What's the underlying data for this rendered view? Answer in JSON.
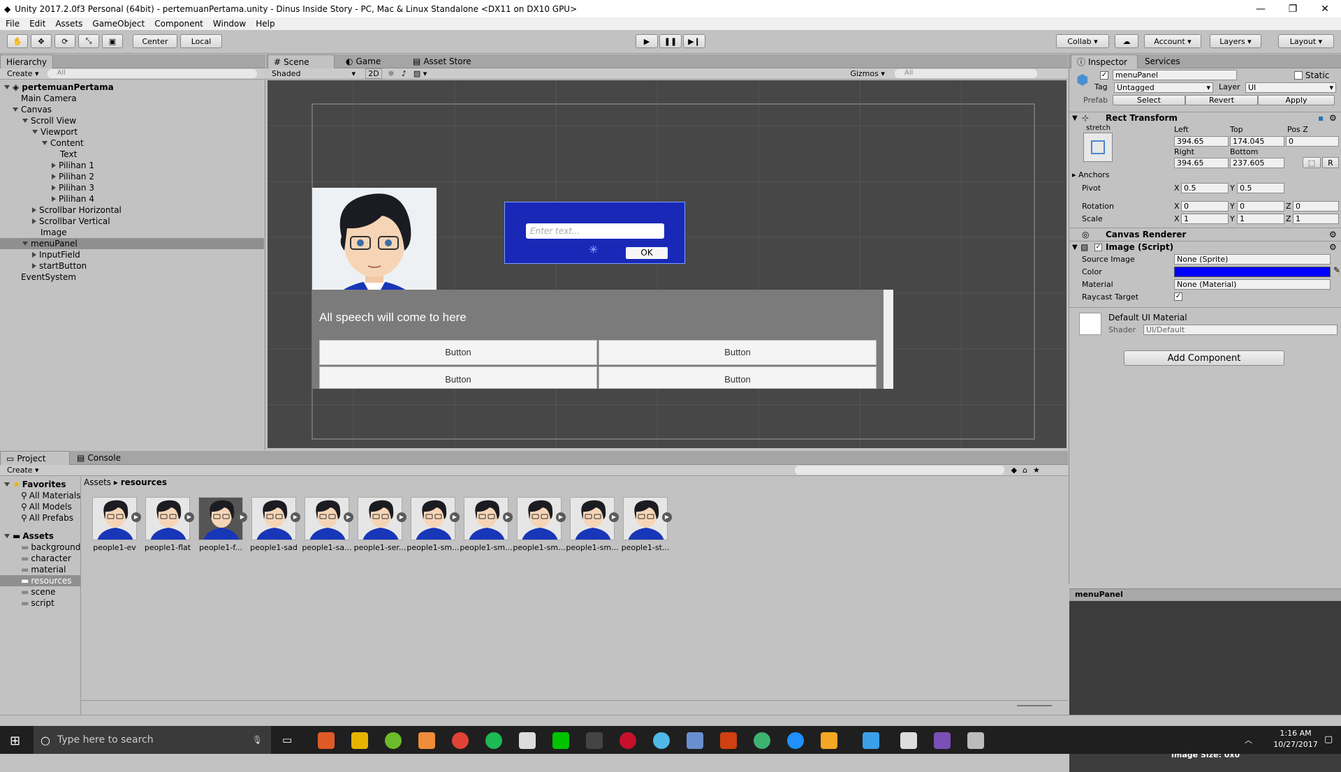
{
  "window": {
    "title": "Unity 2017.2.0f3 Personal (64bit) - pertemuanPertama.unity - Dinus Inside Story - PC, Mac & Linux Standalone <DX11 on DX10 GPU>"
  },
  "menu": [
    "File",
    "Edit",
    "Assets",
    "GameObject",
    "Component",
    "Window",
    "Help"
  ],
  "toolbar": {
    "center": "Center",
    "local": "Local",
    "collab": "Collab",
    "account": "Account",
    "layers": "Layers",
    "layout": "Layout"
  },
  "hierarchy": {
    "tab": "Hierarchy",
    "create": "Create",
    "search_placeholder": "All",
    "scene": "pertemuanPertama",
    "items": [
      "Main Camera",
      "Canvas",
      "Scroll View",
      "Viewport",
      "Content",
      "Text",
      "Pilihan 1",
      "Pilihan 2",
      "Pilihan 3",
      "Pilihan 4",
      "Scrollbar Horizontal",
      "Scrollbar Vertical",
      "Image",
      "menuPanel",
      "InputField",
      "startButton",
      "EventSystem"
    ]
  },
  "scene": {
    "tabs": [
      "Scene",
      "Game",
      "Asset Store"
    ],
    "shading": "Shaded",
    "mode2d": "2D",
    "gizmos": "Gizmos",
    "search_placeholder": "All",
    "input_placeholder": "Enter text...",
    "ok": "OK",
    "speech": "All speech will come to here",
    "button": "Button",
    "panel_color": "#1a28b8"
  },
  "inspector": {
    "tabs": [
      "Inspector",
      "Services"
    ],
    "name": "menuPanel",
    "static": "Static",
    "tag_label": "Tag",
    "tag": "Untagged",
    "layer_label": "Layer",
    "layer": "UI",
    "prefab": "Prefab",
    "select": "Select",
    "revert": "Revert",
    "apply": "Apply",
    "rect": "Rect Transform",
    "stretch": "stretch",
    "left_l": "Left",
    "top_l": "Top",
    "posz_l": "Pos Z",
    "left": "394.65",
    "top": "174.045",
    "posz": "0",
    "right_l": "Right",
    "bottom_l": "Bottom",
    "right": "394.65",
    "bottom": "237.605",
    "r": "R",
    "anchors": "Anchors",
    "pivot": "Pivot",
    "px": "0.5",
    "py": "0.5",
    "rotation": "Rotation",
    "rx": "0",
    "ry": "0",
    "rz": "0",
    "scale": "Scale",
    "sx": "1",
    "sy": "1",
    "sz": "1",
    "x": "X",
    "y": "Y",
    "z": "Z",
    "canvas_renderer": "Canvas Renderer",
    "image_script": "Image (Script)",
    "source_image_l": "Source Image",
    "source_image": "None (Sprite)",
    "color_l": "Color",
    "color": "#0000ff",
    "material_l": "Material",
    "material": "None (Material)",
    "raycast": "Raycast Target",
    "default_mat": "Default UI Material",
    "shader_l": "Shader",
    "shader": "UI/Default",
    "add_component": "Add Component",
    "preview_title": "menuPanel",
    "preview_name": "menuPanel",
    "preview_size": "Image Size: 0x0"
  },
  "project": {
    "tabs": [
      "Project",
      "Console"
    ],
    "create": "Create",
    "favorites": "Favorites",
    "fav_items": [
      "All Materials",
      "All Models",
      "All Prefabs"
    ],
    "assets": "Assets",
    "folders": [
      "background",
      "character",
      "material",
      "resources",
      "scene",
      "script"
    ],
    "breadcrumb": [
      "Assets",
      "resources"
    ],
    "files": [
      "people1-ev",
      "people1-flat",
      "people1-f...",
      "people1-sad",
      "people1-sa...",
      "people1-ser...",
      "people1-sm...",
      "people1-sm...",
      "people1-sm...",
      "people1-sm...",
      "people1-st..."
    ]
  },
  "taskbar": {
    "search": "Type here to search",
    "time": "1:16 AM",
    "date": "10/27/2017"
  }
}
